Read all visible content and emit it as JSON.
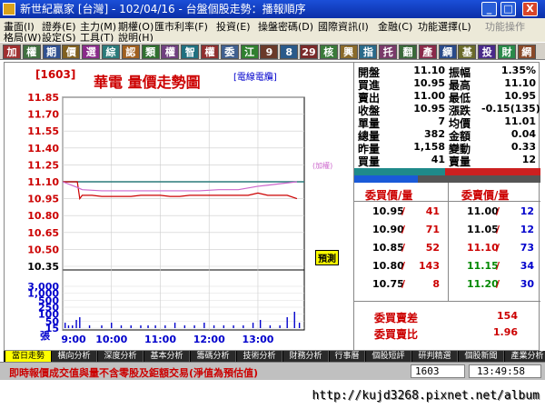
{
  "window": {
    "title": "新世紀贏家 [台灣] - 102/04/16 - 台盤個股走勢：播報順序",
    "min": "_",
    "max": "□",
    "close": "X"
  },
  "menu": {
    "row1": [
      "畫面(I)",
      "證券(E)",
      "主力(M)",
      "期權(O)",
      "匯市利率(F)",
      "投資(E)",
      "操盤密碼(D)",
      "國際資訊(I)",
      "金融(C)",
      "功能選擇(L)",
      "功能操作"
    ],
    "row2": [
      "格局(W)",
      "設定(S)",
      "工具(T)",
      "說明(H)"
    ]
  },
  "toolbar": [
    "加",
    "權",
    "期",
    "價",
    "選",
    "綜",
    "認",
    "類",
    "權",
    "智",
    "權",
    "委",
    "江",
    "9",
    "8",
    "29",
    "核",
    "興",
    "指",
    "托",
    "翻",
    "產",
    "綱",
    "基",
    "投",
    "財",
    "網"
  ],
  "chart_header": {
    "code": "[1603]",
    "title": "華電  量價走勢圖",
    "sub": "[電線電纜]"
  },
  "quote": {
    "rows": [
      {
        "l1": "開盤",
        "v1": "11.10",
        "l2": "振幅",
        "v2": "1.35%"
      },
      {
        "l1": "買進",
        "v1": "10.95",
        "l2": "最高",
        "v2": "11.10"
      },
      {
        "l1": "賣出",
        "v1": "11.00",
        "l2": "最低",
        "v2": "10.95"
      },
      {
        "l1": "收盤",
        "v1": "10.95",
        "l2": "漲跌",
        "v2": "-0.15(135)"
      },
      {
        "l1": "單量",
        "v1": "7",
        "l2": "均價",
        "v2": "11.01"
      },
      {
        "l1": "總量",
        "v1": "382",
        "l2": "金額",
        "v2": "0.04"
      },
      {
        "l1": "昨量",
        "v1": "1,158",
        "l2": "變動",
        "v2": "0.33"
      },
      {
        "l1": "買量",
        "v1": "41",
        "l2": "賣量",
        "v2": "12"
      }
    ]
  },
  "orderbook": {
    "bid_header": "委買價/量",
    "ask_header": "委賣價/量",
    "bids": [
      {
        "p": "10.95",
        "v": "41"
      },
      {
        "p": "10.90",
        "v": "71"
      },
      {
        "p": "10.85",
        "v": "52"
      },
      {
        "p": "10.80",
        "v": "143"
      },
      {
        "p": "10.75",
        "v": "8"
      }
    ],
    "asks": [
      {
        "p": "11.00",
        "v": "12"
      },
      {
        "p": "11.05",
        "v": "12"
      },
      {
        "p": "11.10",
        "v": "73"
      },
      {
        "p": "11.15",
        "v": "34"
      },
      {
        "p": "11.20",
        "v": "30"
      }
    ],
    "diff_label": "委買賣差",
    "diff_value": "154",
    "ratio_label": "委買賣比",
    "ratio_value": "1.96"
  },
  "chart_data": {
    "type": "line",
    "price_ticks": [
      "11.85",
      "11.70",
      "11.55",
      "11.40",
      "11.25",
      "11.10",
      "10.95",
      "10.80",
      "10.65",
      "10.50",
      "10.35"
    ],
    "vol_ticks": [
      "3,000",
      "1,000",
      "500",
      "250",
      "100",
      "50",
      "15"
    ],
    "vol_unit": "張",
    "time_ticks": [
      "9:00",
      "10:00",
      "11:00",
      "12:00",
      "13:00"
    ],
    "ref_line": 11.1,
    "series": [
      {
        "color": "#cc0000",
        "x": [
          0,
          0.3,
          0.35,
          0.4,
          0.6,
          0.8,
          0.9,
          1.0,
          1.2,
          1.4,
          1.6,
          1.8,
          2.0,
          2.2,
          2.4,
          2.6,
          2.8,
          3.0,
          3.2,
          3.4,
          3.6,
          3.8,
          4.0,
          4.2,
          4.4,
          4.6,
          4.8
        ],
        "y": [
          11.1,
          11.1,
          10.95,
          10.98,
          10.98,
          10.97,
          10.97,
          10.97,
          10.97,
          10.97,
          10.98,
          10.98,
          10.98,
          10.97,
          10.97,
          10.98,
          10.98,
          10.98,
          10.98,
          10.98,
          10.98,
          10.98,
          11.0,
          10.98,
          10.98,
          10.98,
          10.95
        ]
      },
      {
        "color": "#cc66cc",
        "x": [
          0,
          0.3,
          0.4,
          0.8,
          1.2,
          1.6,
          2.0,
          2.4,
          2.8,
          3.2,
          3.6,
          4.0,
          4.2,
          4.4,
          4.6,
          4.8
        ],
        "y": [
          11.1,
          11.05,
          11.03,
          11.02,
          11.02,
          11.02,
          11.02,
          11.02,
          11.02,
          11.03,
          11.03,
          11.06,
          11.07,
          11.08,
          11.09,
          11.1
        ]
      }
    ],
    "volume_x": [
      0.05,
      0.12,
      0.2,
      0.28,
      0.35,
      0.55,
      0.8,
      1.0,
      1.2,
      1.4,
      1.6,
      1.75,
      1.9,
      2.1,
      2.3,
      2.5,
      2.7,
      2.9,
      3.1,
      3.3,
      3.5,
      3.7,
      3.9,
      4.05,
      4.25,
      4.45,
      4.6,
      4.75,
      4.85
    ],
    "volume_v": [
      2,
      1,
      1,
      3,
      4,
      1,
      1,
      2,
      1,
      1,
      1,
      1,
      1,
      1,
      2,
      1,
      1,
      2,
      1,
      1,
      1,
      1,
      2,
      3,
      1,
      1,
      4,
      6,
      2
    ],
    "annotation": "(加權)",
    "badge": "預測"
  },
  "bottom_tabs": [
    "當日走勢",
    "橫向分析",
    "深度分析",
    "基本分析",
    "籌碼分析",
    "技術分析",
    "財務分析",
    "行事曆",
    "個股短評",
    "研判精選",
    "個股新聞",
    "產業分析"
  ],
  "status": {
    "message": "即時報價成交值與量不含零股及鉅額交易(淨值為預估值)",
    "code": "1603",
    "time": "13:49:58"
  },
  "watermark": "http://kujd3268.pixnet.net/album"
}
